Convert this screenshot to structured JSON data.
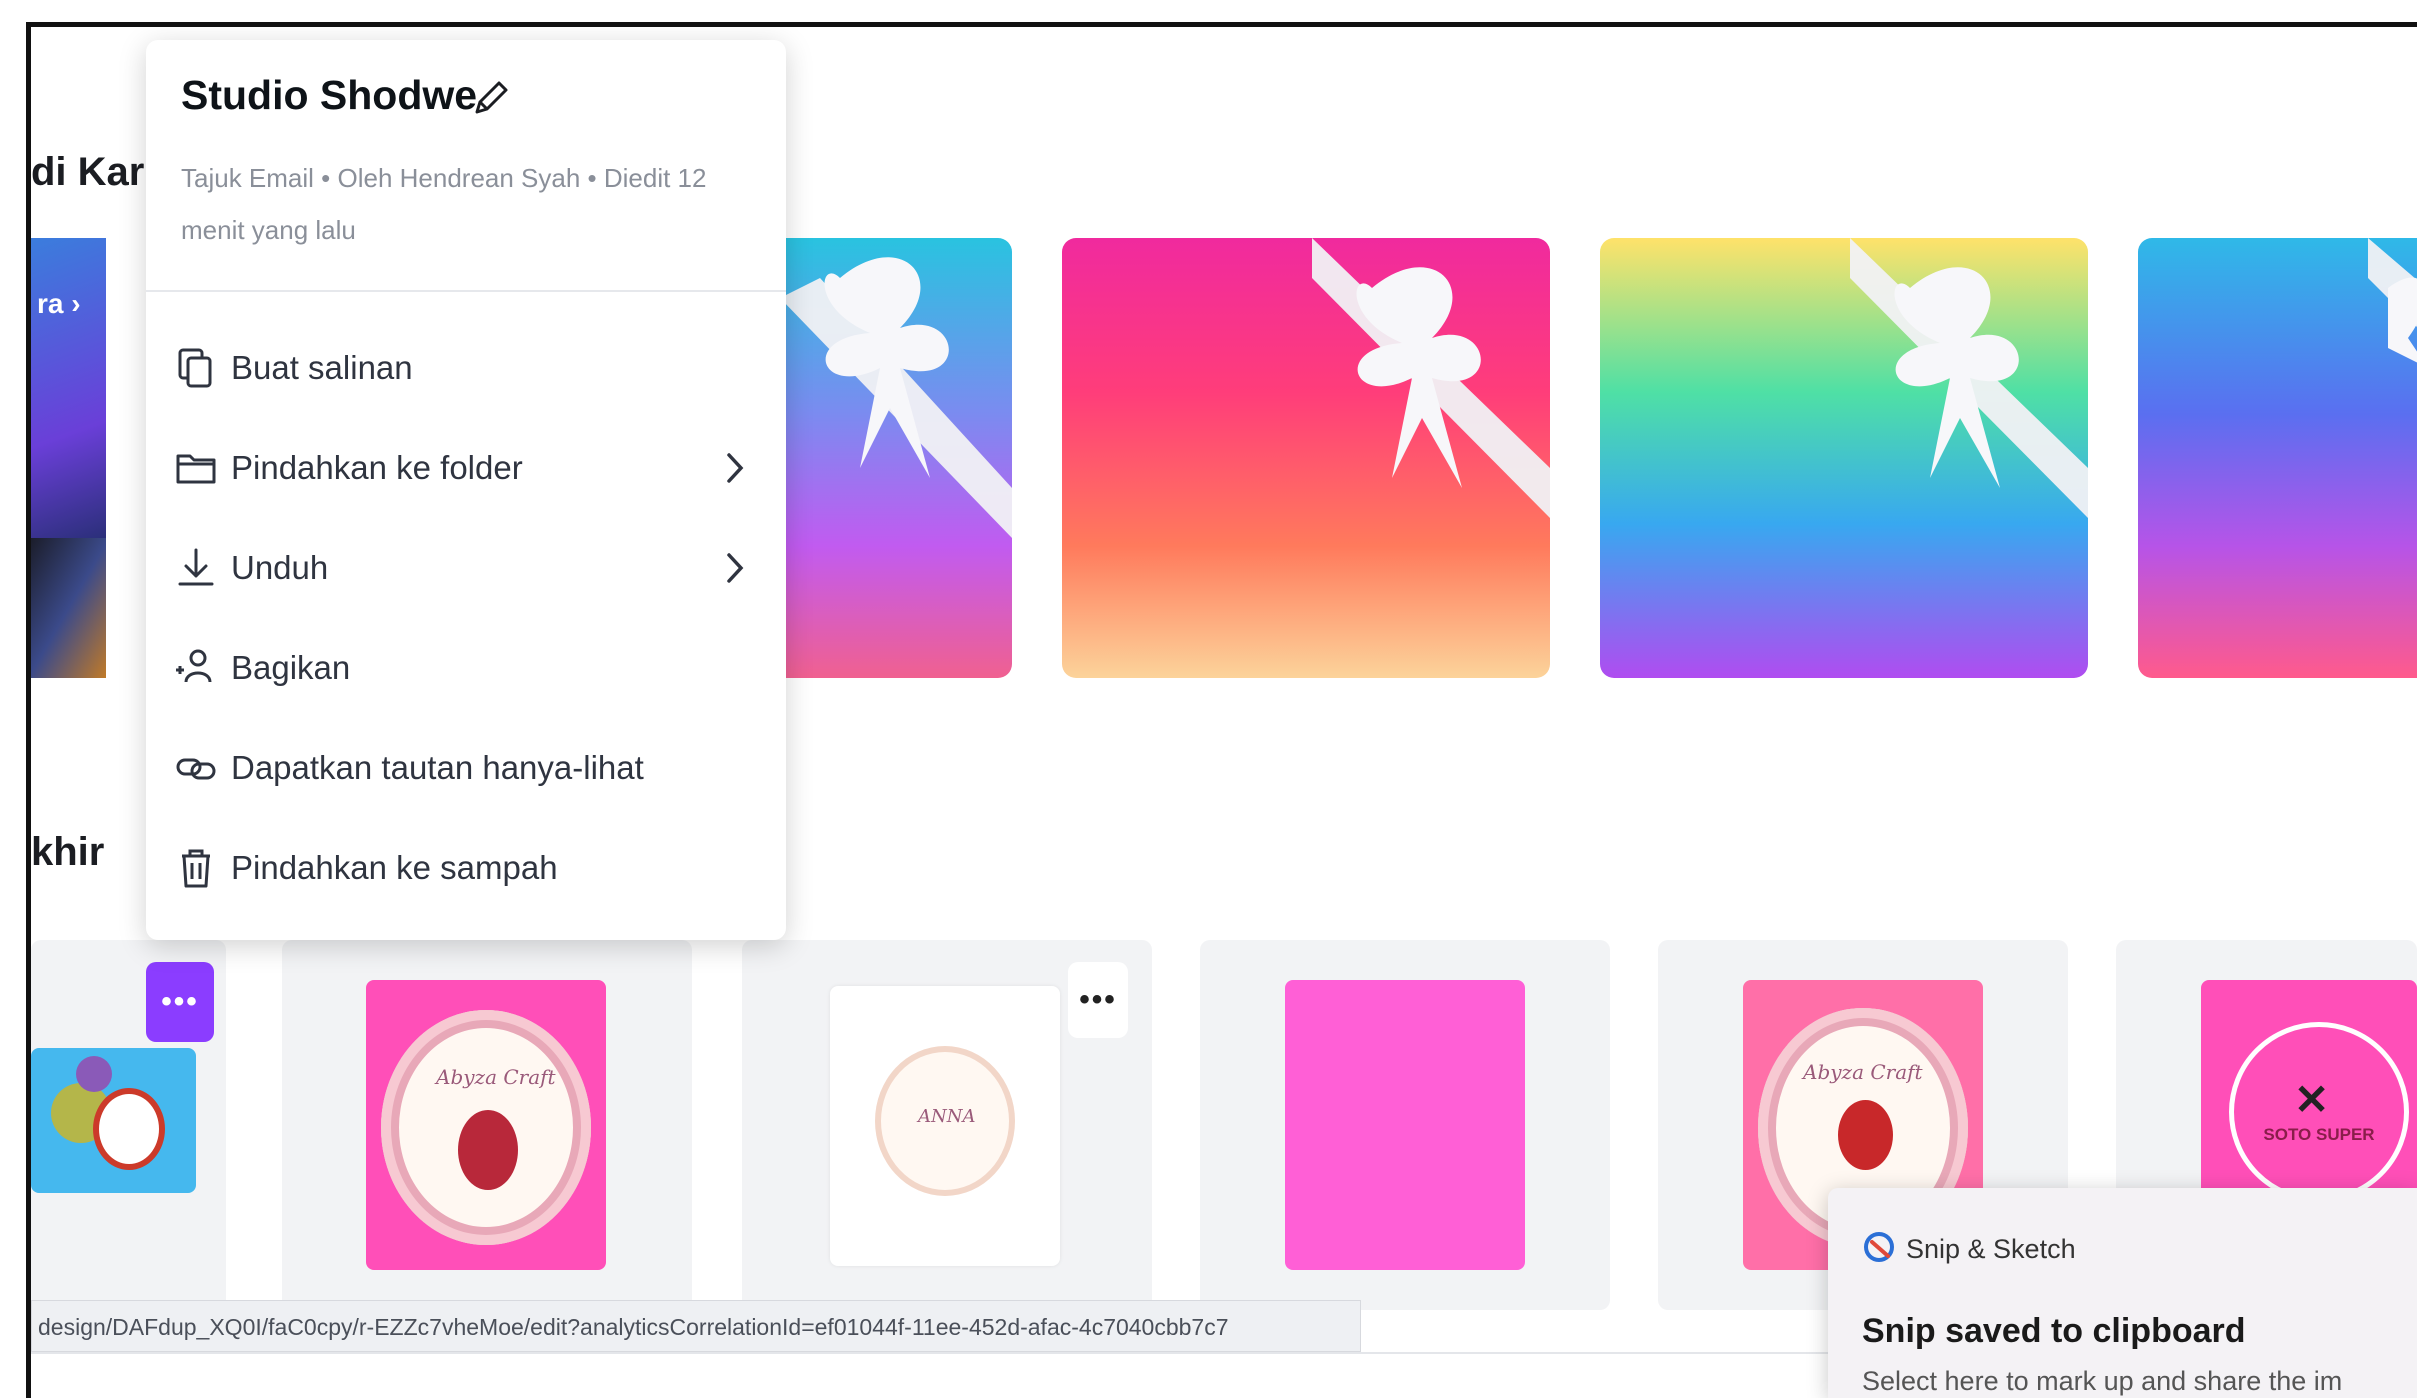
{
  "sidebar_fragments": {
    "top_heading": "di Kar",
    "card_link": "ra ›",
    "bottom_heading": "khir"
  },
  "context_menu": {
    "title": "Studio Shodwe",
    "meta": "Tajuk Email • Oleh Hendrean Syah • Diedit 12 menit yang lalu",
    "items": [
      {
        "label": "Buat salinan",
        "icon": "copy-icon",
        "has_submenu": false
      },
      {
        "label": "Pindahkan ke folder",
        "icon": "folder-icon",
        "has_submenu": true
      },
      {
        "label": "Unduh",
        "icon": "download-icon",
        "has_submenu": true
      },
      {
        "label": "Bagikan",
        "icon": "share-people-icon",
        "has_submenu": false
      },
      {
        "label": "Dapatkan tautan hanya-lihat",
        "icon": "link-icon",
        "has_submenu": false
      },
      {
        "label": "Pindahkan ke sampah",
        "icon": "trash-icon",
        "has_submenu": false
      }
    ]
  },
  "design_cards": [
    {
      "text": "Abyza Craft"
    },
    {
      "text": "ANNA"
    },
    {
      "text": ""
    },
    {
      "text": "Abyza Craft"
    },
    {
      "text": "SOTO SUPER"
    }
  ],
  "more_button_label": "•••",
  "status_url": "design/DAFdup_XQ0I/faC0cpy/r-EZZc7vheMoe/edit?analyticsCorrelationId=ef01044f-11ee-452d-afac-4c7040cbb7c7",
  "toast": {
    "app_name": "Snip & Sketch",
    "title": "Snip saved to clipboard",
    "subtitle": "Select here to mark up and share the im"
  },
  "colors": {
    "accent_purple": "#8b3dff",
    "card_pink": "#ff4fb8"
  }
}
